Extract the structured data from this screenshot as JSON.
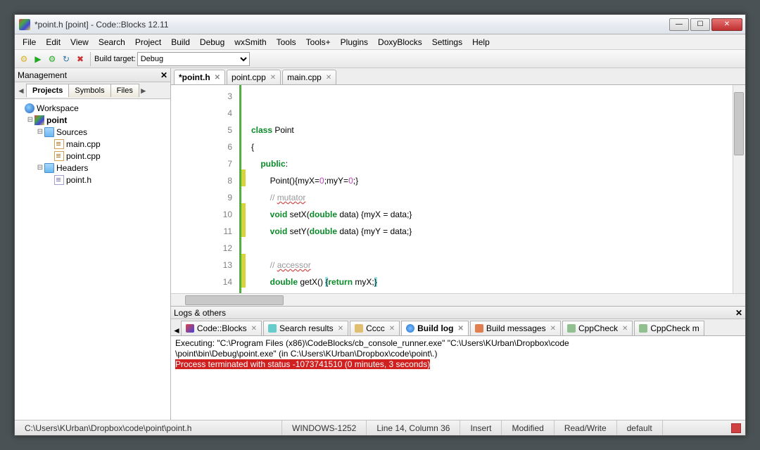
{
  "title": "*point.h [point] - Code::Blocks 12.11",
  "menu": [
    "File",
    "Edit",
    "View",
    "Search",
    "Project",
    "Build",
    "Debug",
    "wxSmith",
    "Tools",
    "Tools+",
    "Plugins",
    "DoxyBlocks",
    "Settings",
    "Help"
  ],
  "toolbar": {
    "build_target_label": "Build target:",
    "build_target_value": "Debug"
  },
  "management": {
    "title": "Management",
    "tabs": [
      "Projects",
      "Symbols",
      "Files"
    ],
    "active_tab": "Projects",
    "tree": {
      "workspace": "Workspace",
      "project": "point",
      "sources_folder": "Sources",
      "sources": [
        "main.cpp",
        "point.cpp"
      ],
      "headers_folder": "Headers",
      "headers": [
        "point.h"
      ]
    }
  },
  "editor": {
    "tabs": [
      {
        "label": "*point.h",
        "active": true
      },
      {
        "label": "point.cpp",
        "active": false
      },
      {
        "label": "main.cpp",
        "active": false
      }
    ],
    "first_line": 3,
    "lines": [
      "",
      "",
      "class Point",
      "{",
      "    public:",
      "        Point(){myX=0;myY=0;}",
      "        // mutator",
      "        void setX(double data) {myX = data;}",
      "        void setY(double data) {myY = data;}",
      "",
      "        // accessor",
      "        double getX() {return myX;}",
      ""
    ],
    "modified_lines": [
      8,
      10,
      11,
      13,
      14
    ]
  },
  "logs": {
    "title": "Logs & others",
    "tabs": [
      "Code::Blocks",
      "Search results",
      "Cccc",
      "Build log",
      "Build messages",
      "CppCheck",
      "CppCheck m"
    ],
    "active_tab": "Build log",
    "line1": "Executing: \"C:\\Program Files (x86)\\CodeBlocks/cb_console_runner.exe\" \"C:\\Users\\KUrban\\Dropbox\\code",
    "line2": "\\point\\bin\\Debug\\point.exe\"  (in C:\\Users\\KUrban\\Dropbox\\code\\point\\.)",
    "line3": "Process terminated with status -1073741510 (0 minutes, 3 seconds)"
  },
  "status": {
    "path": "C:\\Users\\KUrban\\Dropbox\\code\\point\\point.h",
    "encoding": "WINDOWS-1252",
    "pos": "Line 14, Column 36",
    "insert": "Insert",
    "modified": "Modified",
    "rw": "Read/Write",
    "profile": "default"
  }
}
